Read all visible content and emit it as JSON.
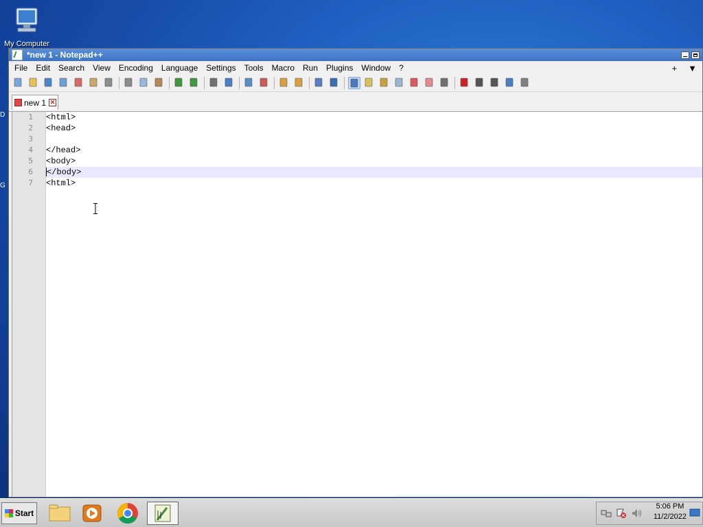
{
  "desktop": {
    "icons": [
      {
        "label": "My Computer",
        "icon": "computer-icon"
      }
    ],
    "edge_glyphs": [
      "D",
      "G"
    ]
  },
  "window": {
    "title": "*new 1 - Notepad++",
    "menu": [
      "File",
      "Edit",
      "Search",
      "View",
      "Encoding",
      "Language",
      "Settings",
      "Tools",
      "Macro",
      "Run",
      "Plugins",
      "Window",
      "?"
    ],
    "menu_right": [
      "+",
      "▼"
    ],
    "toolbar": [
      "new-file-icon",
      "open-file-icon",
      "save-icon",
      "save-all-icon",
      "close-icon",
      "close-all-icon",
      "print-icon",
      "cut-icon",
      "copy-icon",
      "paste-icon",
      "undo-icon",
      "redo-icon",
      "find-icon",
      "replace-icon",
      "zoom-in-icon",
      "zoom-out-icon",
      "sync-vertical-icon",
      "sync-horizontal-icon",
      "word-wrap-icon",
      "show-all-characters-icon",
      "indent-guide-icon",
      "user-defined-language-icon",
      "document-map-icon",
      "document-list-icon",
      "function-list-icon",
      "folder-as-workspace-icon",
      "monitoring-icon",
      "record-macro-icon",
      "stop-recording-icon",
      "play-macro-icon",
      "run-macro-multiple-icon",
      "save-macro-icon"
    ],
    "tab": {
      "label": "new 1"
    },
    "lines": [
      "<html>",
      "<head>",
      "",
      "</head>",
      "<body>",
      "</body>",
      "<html>"
    ],
    "current_line": 6,
    "line_numbers": [
      "1",
      "2",
      "3",
      "4",
      "5",
      "6",
      "7"
    ]
  },
  "taskbar": {
    "start_label": "Start",
    "apps": [
      "file-explorer-icon",
      "media-player-icon",
      "chrome-icon",
      "notepadplusplus-icon"
    ],
    "tray": [
      "network-icon",
      "action-center-icon",
      "volume-icon"
    ],
    "time": "5:06 PM",
    "date": "11/2/2022"
  }
}
